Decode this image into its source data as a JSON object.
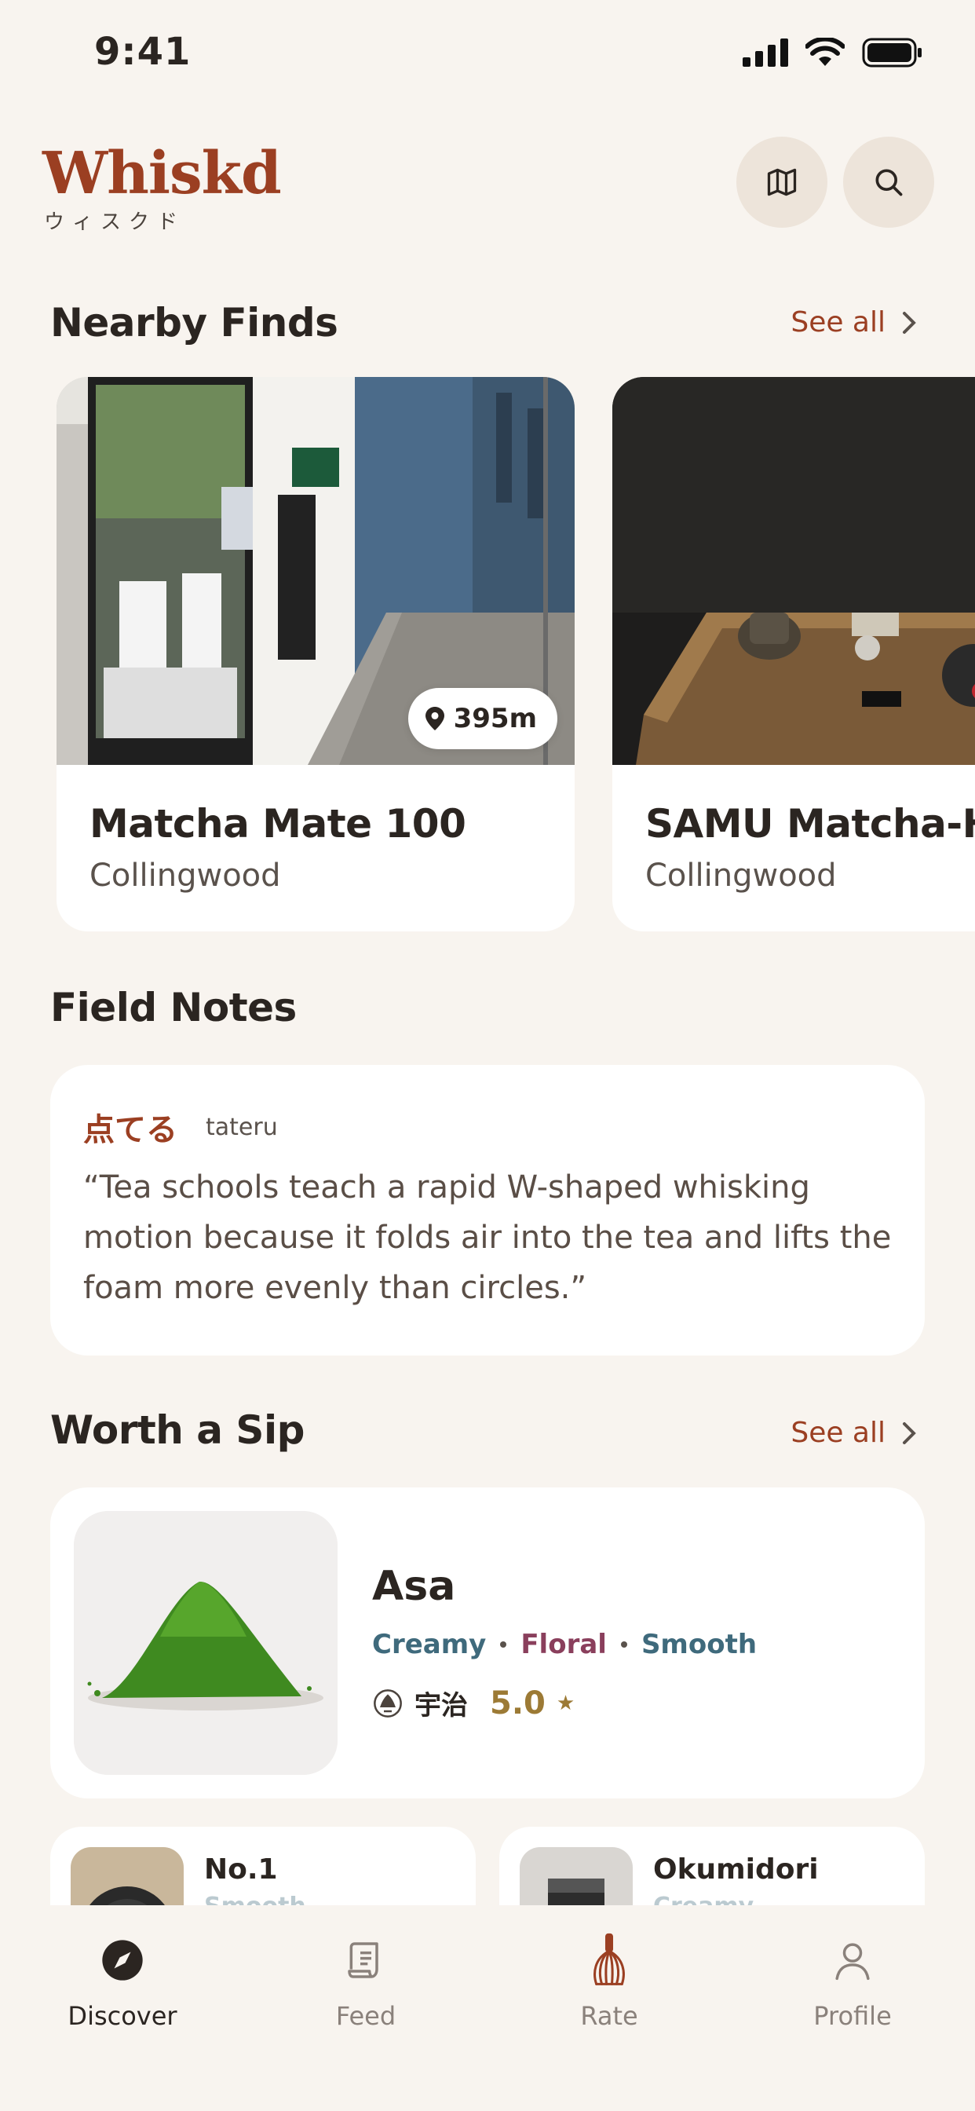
{
  "status_bar": {
    "time": "9:41"
  },
  "header": {
    "brand": "Whiskd",
    "brand_sub": "ウィスクド"
  },
  "nearby": {
    "title": "Nearby Finds",
    "see_all": "See all",
    "cards": [
      {
        "name": "Matcha Mate 100",
        "area": "Collingwood",
        "distance": "395m"
      },
      {
        "name": "SAMU Matcha-House",
        "area": "Collingwood"
      }
    ]
  },
  "field_notes": {
    "title": "Field Notes",
    "term_jp": "点てる",
    "term_romaji": "tateru",
    "quote": "“Tea schools teach a rapid W-shaped whisking motion because it folds air into the tea and lifts the foam more evenly than circles.”"
  },
  "worth_a_sip": {
    "title": "Worth a Sip",
    "see_all": "See all",
    "featured": {
      "name": "Asa",
      "tags": [
        {
          "label": "Creamy",
          "color": "#3f6a7c"
        },
        {
          "label": "Floral",
          "color": "#8a3f5c"
        },
        {
          "label": "Smooth",
          "color": "#3f6a7c"
        }
      ],
      "origin": "宇治",
      "rating": "5.0"
    },
    "more": [
      {
        "name": "No.1",
        "tag": "Smooth"
      },
      {
        "name": "Okumidori",
        "tag": "Creamy"
      }
    ]
  },
  "tabs": [
    {
      "label": "Discover",
      "icon": "compass-icon",
      "active": true
    },
    {
      "label": "Feed",
      "icon": "scroll-icon",
      "active": false
    },
    {
      "label": "Rate",
      "icon": "whisk-icon",
      "active": false
    },
    {
      "label": "Profile",
      "icon": "person-icon",
      "active": false
    }
  ],
  "colors": {
    "accent": "#9b3f22",
    "background": "#f8f4ef",
    "gold": "#9c7a35"
  }
}
